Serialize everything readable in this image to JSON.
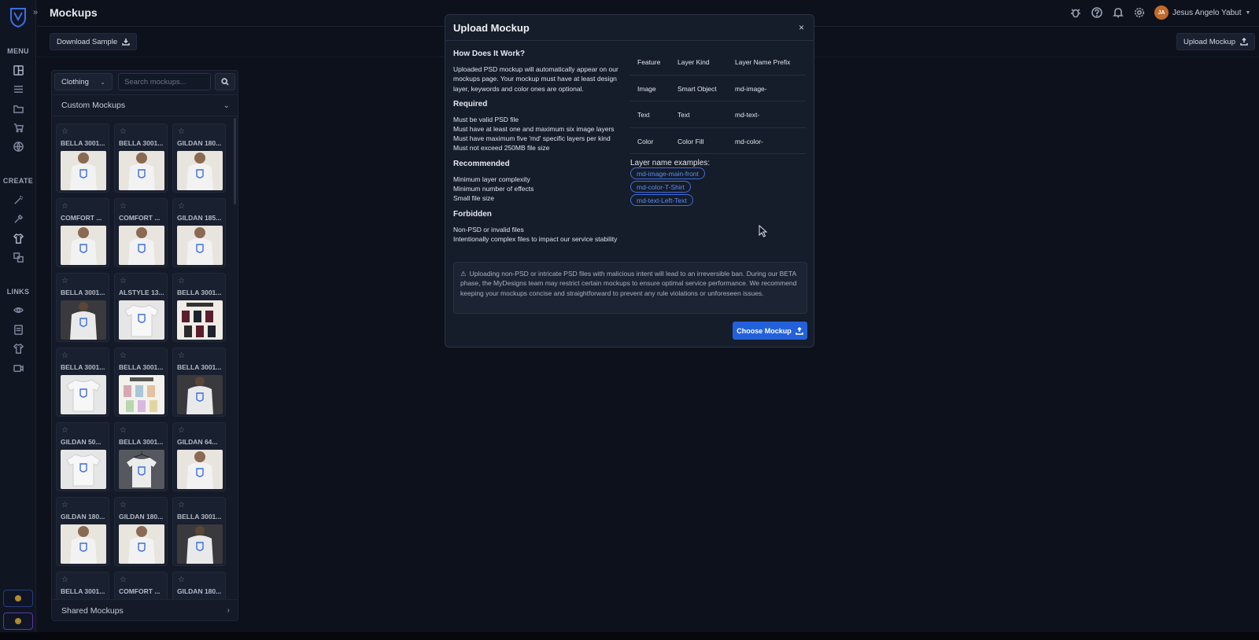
{
  "page": {
    "title": "Mockups"
  },
  "sidebar": {
    "sections": [
      "MENU",
      "CREATE",
      "LINKS"
    ]
  },
  "header": {
    "user_initials": "JA",
    "user_name": "Jesus Angelo Yabut"
  },
  "toolbar": {
    "download_sample": "Download Sample",
    "upload_mockup": "Upload Mockup"
  },
  "panel": {
    "category": "Clothing",
    "search_placeholder": "Search mockups...",
    "custom_section": "Custom Mockups",
    "shared_section": "Shared Mockups",
    "cards": [
      {
        "name": "BELLA 3001...",
        "thumb": "person"
      },
      {
        "name": "BELLA 3001...",
        "thumb": "person"
      },
      {
        "name": "GILDAN 180...",
        "thumb": "person"
      },
      {
        "name": "COMFORT ...",
        "thumb": "person"
      },
      {
        "name": "COMFORT ...",
        "thumb": "person"
      },
      {
        "name": "GILDAN 185...",
        "thumb": "person"
      },
      {
        "name": "BELLA 3001...",
        "thumb": "dark"
      },
      {
        "name": "ALSTYLE 13...",
        "thumb": "shirt"
      },
      {
        "name": "BELLA 3001...",
        "thumb": "chart"
      },
      {
        "name": "BELLA 3001...",
        "thumb": "shirt"
      },
      {
        "name": "BELLA 3001...",
        "thumb": "chart-light"
      },
      {
        "name": "BELLA 3001...",
        "thumb": "dark"
      },
      {
        "name": "GILDAN 50...",
        "thumb": "shirt"
      },
      {
        "name": "BELLA 3001...",
        "thumb": "hanger"
      },
      {
        "name": "GILDAN 64...",
        "thumb": "person"
      },
      {
        "name": "GILDAN 180...",
        "thumb": "person"
      },
      {
        "name": "GILDAN 180...",
        "thumb": "person"
      },
      {
        "name": "BELLA 3001...",
        "thumb": "dark"
      },
      {
        "name": "BELLA 3001...",
        "thumb": "shirt"
      },
      {
        "name": "COMFORT ...",
        "thumb": "shirt"
      },
      {
        "name": "GILDAN 180...",
        "thumb": "shirt"
      }
    ]
  },
  "modal": {
    "title": "Upload Mockup",
    "close": "×",
    "how_title": "How Does It Work?",
    "how_text": "Uploaded PSD mockup will automatically appear on our mockups page. Your mockup must have at least design layer, keywords and color ones are optional.",
    "required_title": "Required",
    "required_items": [
      "Must be valid PSD file",
      "Must have at least one and maximum six image layers",
      "Must have maximum five 'md' specific layers per kind",
      "Must not exceed 250MB file size"
    ],
    "recommended_title": "Recommended",
    "recommended_items": [
      "Minimum layer complexity",
      "Minimum number of effects",
      "Small file size"
    ],
    "forbidden_title": "Forbidden",
    "forbidden_items": [
      "Non-PSD or invalid files",
      "Intentionally complex files to impact our service stability"
    ],
    "table": {
      "headers": [
        "Feature",
        "Layer Kind",
        "Layer Name Prefix"
      ],
      "rows": [
        [
          "Image",
          "Smart Object",
          "md-image-"
        ],
        [
          "Text",
          "Text",
          "md-text-"
        ],
        [
          "Color",
          "Color Fill",
          "md-color-"
        ]
      ]
    },
    "examples_title": "Layer name examples:",
    "examples": [
      "md-image-main-front",
      "md-color-T-Shirt",
      "md-text-Left-Text"
    ],
    "warning": "Uploading non-PSD or intricate PSD files with malicious intent will lead to an irreversible ban. During our BETA phase, the MyDesigns team may restrict certain mockups to ensure optimal service performance. We recommend keeping your mockups concise and straightforward to prevent any rule violations or unforeseen issues.",
    "choose_button": "Choose Mockup"
  },
  "colors": {
    "background": "#0d111b",
    "accent": "#2361db",
    "pill": "#3d6fe0"
  }
}
